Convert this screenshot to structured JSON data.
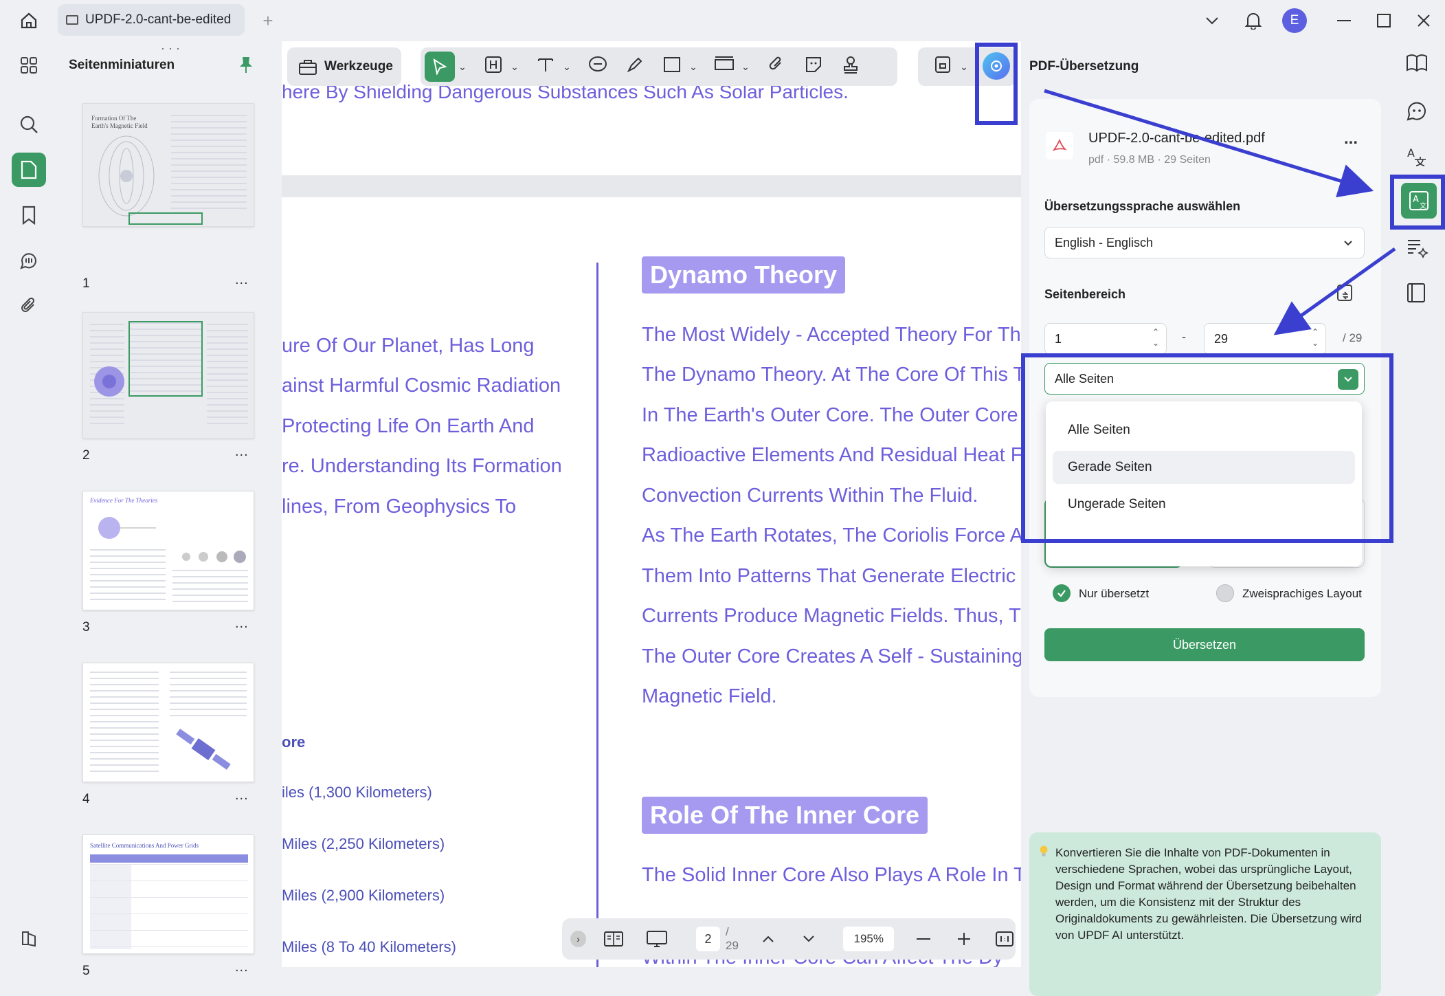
{
  "titlebar": {
    "tab_title": "UPDF-2.0-cant-be-edited",
    "avatar_letter": "E"
  },
  "thumbnails": {
    "title": "Seitenminiaturen",
    "pages": [
      {
        "num": "1",
        "more": "...",
        "heading": "Formation Of The Earth's Magnetic Field"
      },
      {
        "num": "2",
        "more": "..."
      },
      {
        "num": "3",
        "more": "...",
        "heading": "Evidence For The Theories"
      },
      {
        "num": "4",
        "more": "..."
      },
      {
        "num": "5",
        "more": "...",
        "heading": "Satellite Communications And Power Grids"
      }
    ]
  },
  "toolbar": {
    "tools_label": "Werkzeuge"
  },
  "document": {
    "top_line": "here By Shielding Dangerous Substances Such As Solar Particles.",
    "left_lines": [
      "ure Of Our Planet, Has Long",
      "ainst Harmful Cosmic Radiation",
      "Protecting Life On Earth And",
      "re. Understanding Its Formation",
      "lines, From Geophysics To"
    ],
    "left_bold": "ore",
    "left_measures": [
      "iles (1,300 Kilometers)",
      "Miles (2,250 Kilometers)",
      "Miles (2,900 Kilometers)",
      "Miles (8 To 40 Kilometers)"
    ],
    "heading1": "Dynamo Theory",
    "right_lines": [
      "The Most Widely - Accepted Theory For Th",
      "The Dynamo Theory. At The Core Of This T",
      "In The Earth's Outer Core. The Outer Core I",
      "Radioactive Elements And Residual Heat Fr",
      "Convection Currents Within The Fluid.",
      "As The Earth Rotates, The Coriolis Force Ac",
      "Them Into Patterns That Generate Electric C",
      "Currents Produce Magnetic Fields. Thus, Th",
      "The Outer Core Creates A Self - Sustaining",
      "Magnetic Field."
    ],
    "heading2": "Role Of The Inner Core",
    "right_lines2": [
      "The Solid Inner Core Also Plays A Role In Th",
      "Within The Inner Core Can Affect The Dy"
    ]
  },
  "bottombar": {
    "page_current": "2",
    "page_total": "/ 29",
    "zoom": "195%"
  },
  "translate_panel": {
    "title": "PDF-Übersetzung",
    "file_name": "UPDF-2.0-cant-be-edited.pdf",
    "file_meta": "pdf · 59.8 MB · 29 Seiten",
    "more": "...",
    "language_label": "Übersetzungssprache auswählen",
    "language_value": "English - Englisch",
    "range_label": "Seitenbereich",
    "range_from": "1",
    "range_dash": "-",
    "range_to": "29",
    "range_total": "/ 29",
    "pages_select_value": "Alle Seiten",
    "dropdown_options": [
      "Alle Seiten",
      "Gerade Seiten",
      "Ungerade Seiten"
    ],
    "option_translated_only": "Nur übersetzt",
    "option_bilingual": "Zweisprachiges Layout",
    "translate_button": "Übersetzen",
    "info_text": "Konvertieren Sie die Inhalte von PDF-Dokumenten in verschiedene Sprachen, wobei das ursprüngliche Layout, Design und Format während der Übersetzung beibehalten werden, um die Konsistenz mit der Struktur des Originaldokuments zu gewährleisten. Die Übersetzung wird von UPDF AI unterstützt."
  },
  "colors": {
    "accent_green": "#3b9a63",
    "highlight_blue": "#3a3fd0",
    "doc_text": "#6d5fdc",
    "doc_heading_bg": "#a69af0"
  }
}
